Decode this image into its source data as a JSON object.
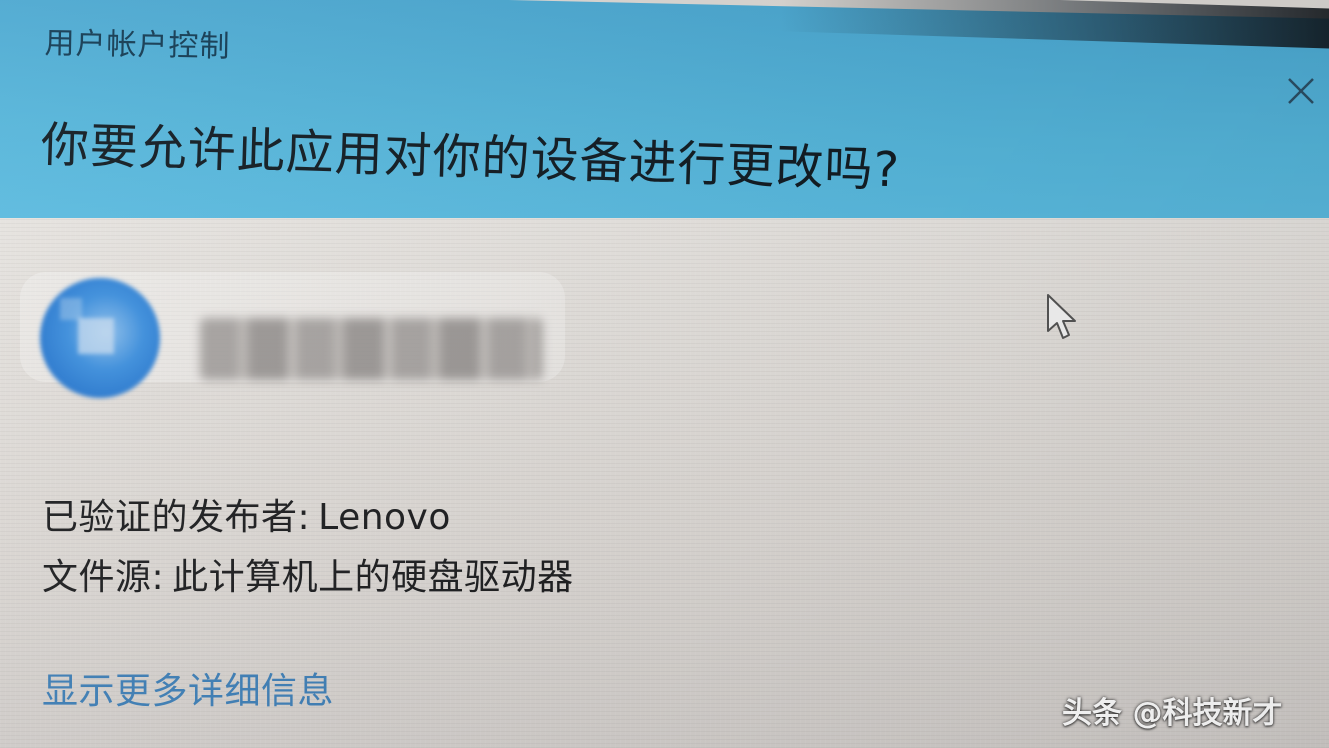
{
  "dialog": {
    "title": "用户帐户控制",
    "question": "你要允许此应用对你的设备进行更改吗?",
    "close_icon": "close-icon"
  },
  "app": {
    "icon": "app-icon-blurred",
    "name_obscured": true
  },
  "details": {
    "publisher_label": "已验证的发布者:",
    "publisher_value": "Lenovo",
    "source_label": "文件源:",
    "source_value": "此计算机上的硬盘驱动器",
    "more_link": "显示更多详细信息"
  },
  "watermark": {
    "text": "头条 @科技新才"
  },
  "colors": {
    "header_blue": "#54b4d9",
    "body_gray": "#dcd8d4",
    "link_blue": "#3f7fb6"
  }
}
